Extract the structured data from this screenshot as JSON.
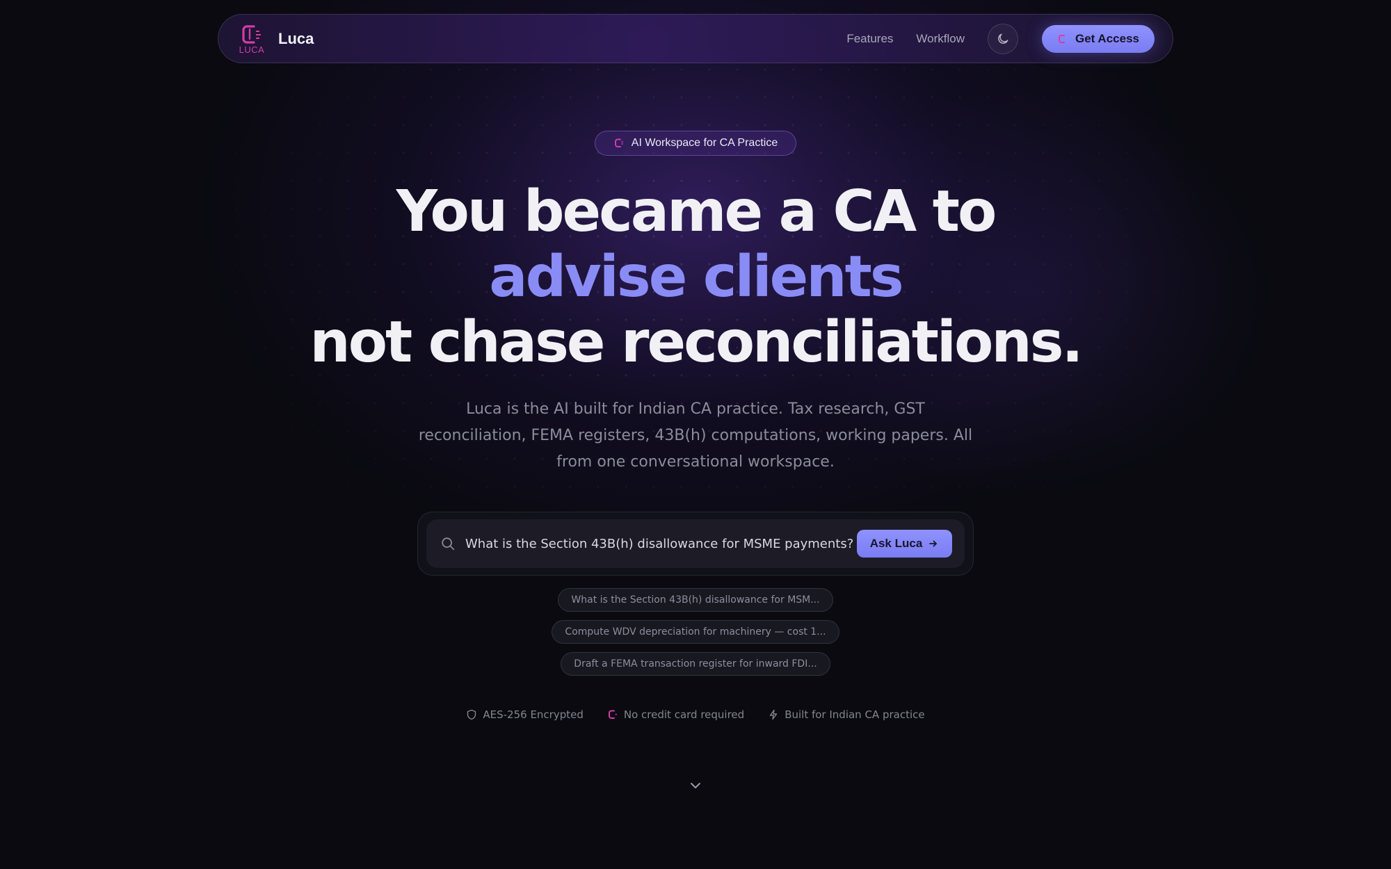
{
  "nav": {
    "brand_name": "Luca",
    "logo_text": "LUCA",
    "links": [
      "Features",
      "Workflow"
    ],
    "theme_icon": "moon-icon",
    "cta_label": "Get Access"
  },
  "hero": {
    "badge": "AI Workspace for CA Practice",
    "headline_line1": "You became a CA to",
    "headline_line2": "advise clients",
    "headline_line3": "not chase reconciliations.",
    "subtitle": "Luca is the AI built for Indian CA practice. Tax research, GST reconciliation, FEMA registers, 43B(h) computations, working papers. All from one conversational workspace."
  },
  "search": {
    "value": "What is the Section 43B(h) disallowance for MSME payments?",
    "button_label": "Ask Luca"
  },
  "suggestions": [
    "What is the Section 43B(h) disallowance for MSM...",
    "Compute WDV depreciation for machinery — cost 1...",
    "Draft a FEMA transaction register for inward FDI..."
  ],
  "trust": [
    {
      "icon": "shield-icon",
      "label": "AES-256 Encrypted"
    },
    {
      "icon": "luca-logo-icon",
      "label": "No credit card required"
    },
    {
      "icon": "lightning-icon",
      "label": "Built for Indian CA practice"
    }
  ],
  "colors": {
    "background": "#0a0a10",
    "accent": "#8a8cf6",
    "logo": "#d23ca8"
  }
}
